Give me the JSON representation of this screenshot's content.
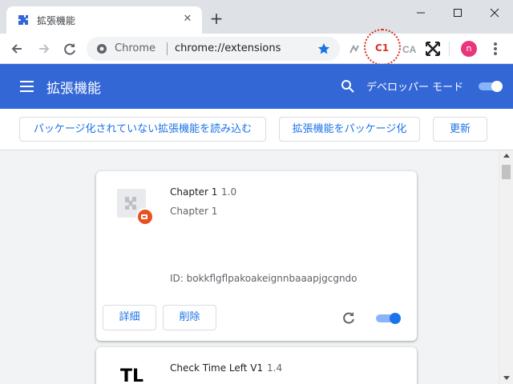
{
  "browser": {
    "tab_title": "拡張機能",
    "tab_close_glyph": "✕",
    "new_tab_glyph": "+",
    "window_min": "—",
    "window_max": "☐",
    "window_close": "✕",
    "omnibox_scheme_label": "Chrome",
    "omnibox_url": "chrome://extensions",
    "avatar_letter": "n",
    "annotation_label": "C1"
  },
  "header": {
    "title": "拡張機能",
    "dev_mode_label": "デベロッパー モード",
    "dev_mode_on": true
  },
  "actions": {
    "load_unpacked": "パッケージ化されていない拡張機能を読み込む",
    "pack": "拡張機能をパッケージ化",
    "update": "更新"
  },
  "extensions": [
    {
      "name": "Chapter 1",
      "version": "1.0",
      "description": "Chapter 1",
      "id": "ID: bokkflgflpakoakeignnbaaapjgcgndo",
      "details_label": "詳細",
      "remove_label": "削除",
      "enabled": true
    },
    {
      "name": "Check Time Left V1",
      "version": "1.4",
      "logo_text": "TL"
    }
  ],
  "colors": {
    "header_blue": "#3367d6",
    "link_blue": "#1a73e8",
    "annotation_red": "#d93025",
    "avatar_pink": "#e8357c"
  }
}
